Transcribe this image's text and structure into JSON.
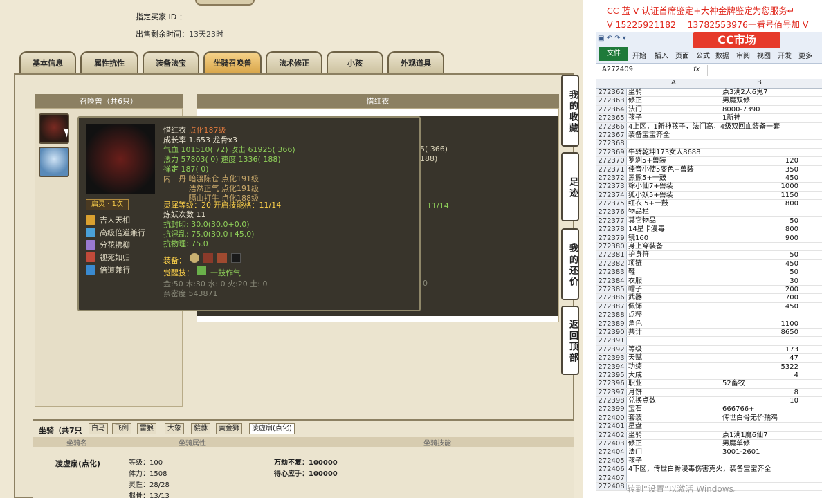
{
  "game": {
    "designated_buyer_label": "指定买家 ID ：",
    "time_label": "出售剩余时间：",
    "time_value": "13天23时",
    "tabs": [
      "基本信息",
      "属性抗性",
      "装备法宝",
      "坐骑召唤兽",
      "法术修正",
      "小孩",
      "外观道具"
    ],
    "active_tab": "坐骑召唤兽",
    "pet_panel_title": "召唤兽（共6只）",
    "detail_panel_title": "惜红衣",
    "side_buttons": [
      "我的收藏",
      "足迹",
      "我的还价",
      "返回顶部"
    ],
    "bg_fragments": [
      "5( 366)",
      "188)",
      "11/14",
      "0"
    ],
    "tooltip": {
      "name": "惜红衣",
      "name_tag": "点化187级",
      "growth": "成长率 1.653 龙骨x3",
      "hp_line": "气血 101510( 72) 攻击 61925( 366)",
      "mp_line": "法力 57803( 0) 速度 1336( 188)",
      "shen": "禅定 187( 0)",
      "neidan": [
        "内　丹 暗渡陈仓 点化191级",
        "　　　 浩然正气 点化191级",
        "　　　 隔山打牛 点化188级"
      ],
      "qiling_level": "灵犀等级：20 开启技能格：11/14",
      "lianyao": "炼妖次数 11",
      "res1": "抗封印: 30.0(30.0+0.0)",
      "res2": "抗混乱: 75.0(30.0+45.0)",
      "res3": "抗物理: 75.0",
      "equip_label": "装备：",
      "awaken_label": "觉醒技：",
      "awaken_skill": "一鼓作气",
      "elements": "金:50 木:30 水: 0 火:20 土: 0",
      "intimacy": "亲密度 543871",
      "qiling_badge": "启灵 · 1次",
      "skills": [
        "吉人天相",
        "高级倍道兼行",
        "分花拂柳",
        "视死如归",
        "倍道兼行"
      ]
    },
    "mounts": {
      "title": "坐骑（共7只",
      "tabs": [
        "白马",
        "飞剑",
        "雷狼",
        "大象",
        "貔貅",
        "黄金狮",
        "凌虚扇(点化)"
      ],
      "col_name": "坐骑名",
      "col_attr": "坐骑属性",
      "col_skill": "坐骑技能",
      "name": "凌虚扇(点化)",
      "attrs": [
        "等级：100",
        "体力：1508",
        "灵性：28/28",
        "根骨：13/13"
      ],
      "skills": [
        "万劫不复：100000",
        "得心应手：100000"
      ]
    }
  },
  "excel": {
    "ad_line1": "CC 蓝 V 认证首席鉴定+大神金牌鉴定为您服务↵",
    "ad_line2": "V 15225921182　 13782553976一看号佰号加 V",
    "logo": "CC市场",
    "tabs": [
      "文件",
      "开始",
      "插入",
      "页面",
      "公式",
      "数据",
      "审阅",
      "视图",
      "开发",
      "更多"
    ],
    "cell_ref": "A272409",
    "fx": "fx",
    "col_a": "A",
    "col_b": "B",
    "watermark": "转到“设置”以激活 Windows。",
    "rows": [
      [
        "272362",
        "坐骑",
        "点3满2人6鬼7"
      ],
      [
        "272363",
        "修正",
        "男魔双修"
      ],
      [
        "272364",
        "法门",
        "8000-7390"
      ],
      [
        "272365",
        "孩子",
        "1新神"
      ],
      [
        "272366",
        "4上区，1新神孩子，法门高，4级双回血装备一套",
        ""
      ],
      [
        "272367",
        "装备宝宝齐全",
        ""
      ],
      [
        "272368",
        "",
        ""
      ],
      [
        "272369",
        "牛转乾坤173女人8688",
        ""
      ],
      [
        "272370",
        "罗刹5+兽装",
        "120"
      ],
      [
        "272371",
        "佳音小使5变色+兽装",
        "350"
      ],
      [
        "272372",
        "黑熊5+一鼓",
        "450"
      ],
      [
        "272373",
        "粽小仙7+兽装",
        "1000"
      ],
      [
        "272374",
        "狐小妖5+兽装",
        "1150"
      ],
      [
        "272375",
        "红衣 5+一鼓",
        "800"
      ],
      [
        "272376",
        "物品栏",
        ""
      ],
      [
        "272377",
        "其它物品",
        "50"
      ],
      [
        "272378",
        "14星卡漫毒",
        "800"
      ],
      [
        "272379",
        "镜160",
        "900"
      ],
      [
        "272380",
        "身上穿装备",
        ""
      ],
      [
        "272381",
        "护身符",
        "50"
      ],
      [
        "272382",
        "项链",
        "450"
      ],
      [
        "272383",
        "鞋",
        "50"
      ],
      [
        "272384",
        "衣服",
        "30"
      ],
      [
        "272385",
        "帽子",
        "200"
      ],
      [
        "272386",
        "武器",
        "700"
      ],
      [
        "272387",
        "佩饰",
        "450"
      ],
      [
        "272388",
        "点粹",
        ""
      ],
      [
        "272389",
        "角色",
        "1100"
      ],
      [
        "272390",
        "共计",
        "8650"
      ],
      [
        "272391",
        "",
        ""
      ],
      [
        "272392",
        "等级",
        "173"
      ],
      [
        "272393",
        "天赋",
        "47"
      ],
      [
        "272394",
        "功绩",
        "5322"
      ],
      [
        "272395",
        "大成",
        "4"
      ],
      [
        "272396",
        "职业",
        "52畜牧"
      ],
      [
        "272397",
        "月饼",
        "8"
      ],
      [
        "272398",
        "兑换点数",
        "10"
      ],
      [
        "272399",
        "宝石",
        "666766+"
      ],
      [
        "272400",
        "套装",
        "传世白骨无价孺鸡"
      ],
      [
        "272401",
        "星盘",
        ""
      ],
      [
        "272402",
        "坐骑",
        "点1满1魔6仙7"
      ],
      [
        "272403",
        "修正",
        "男魔单修"
      ],
      [
        "272404",
        "法门",
        "3001-2601"
      ],
      [
        "272405",
        "孩子",
        ""
      ],
      [
        "272406",
        "4下区，传世白骨漫毒伤害克火，装备宝宝齐全",
        ""
      ],
      [
        "272407",
        "",
        ""
      ],
      [
        "272408",
        "",
        ""
      ]
    ]
  }
}
